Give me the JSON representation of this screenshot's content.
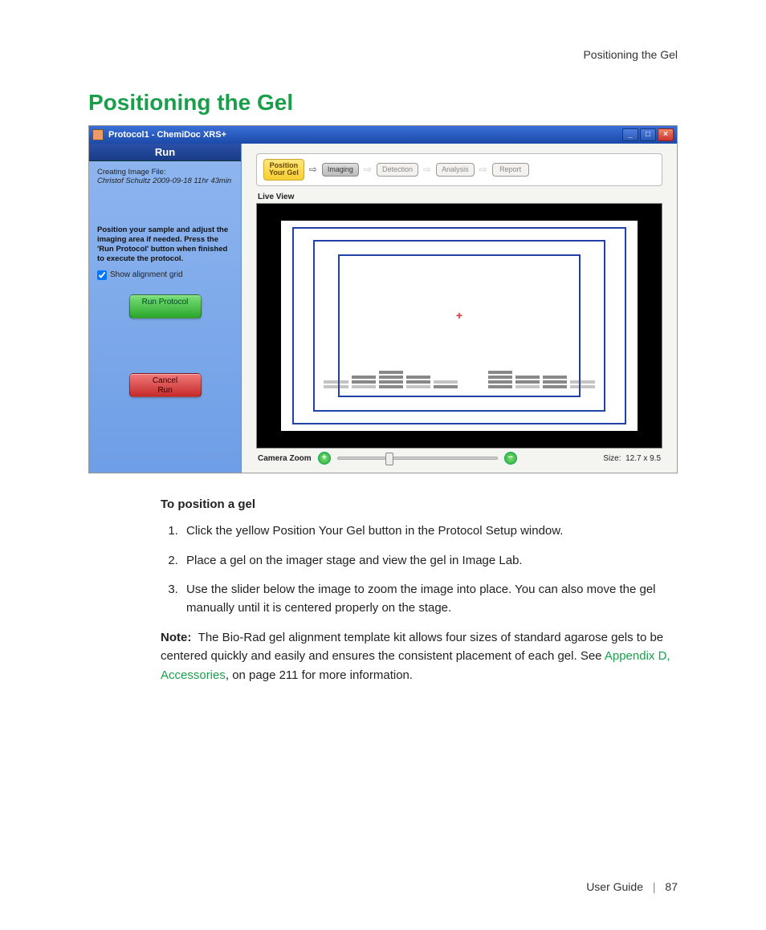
{
  "header": {
    "running_head": "Positioning the Gel"
  },
  "section": {
    "title": "Positioning the Gel"
  },
  "window": {
    "title": "Protocol1 - ChemiDoc XRS+",
    "controls": {
      "min": "_",
      "max": "□",
      "close": "×"
    }
  },
  "sidebar": {
    "title": "Run",
    "creating_label": "Creating Image File:",
    "creating_value": "Christof Schultz 2009-09-18 11hr 43min",
    "instruction": "Position your sample and adjust the imaging area if needed. Press the 'Run Protocol' button when finished to execute the protocol.",
    "checkbox_label": "Show alignment grid",
    "checkbox_checked": true,
    "run_button": "Run Protocol",
    "cancel_button": "Cancel\nRun"
  },
  "stepbar": {
    "steps": [
      {
        "label": "Position\nYour Gel",
        "state": "active-yellow"
      },
      {
        "label": "Imaging",
        "state": "active-grey"
      },
      {
        "label": "Detection",
        "state": "disabled"
      },
      {
        "label": "Analysis",
        "state": "disabled"
      },
      {
        "label": "Report",
        "state": "disabled"
      }
    ]
  },
  "viewer": {
    "label": "Live View",
    "zoom_label": "Camera Zoom",
    "size_label": "Size:",
    "size_value": "12.7  x  9.5"
  },
  "body": {
    "subheading": "To position a gel",
    "steps": [
      "Click the yellow Position Your Gel button in the Protocol Setup window.",
      "Place a gel on the imager stage and view the gel in Image Lab.",
      "Use the slider below the image to zoom the image into place. You can also move the gel manually until it is centered properly on the stage."
    ],
    "note_label": "Note:",
    "note_pre": "The Bio-Rad gel alignment template kit allows four sizes of standard agarose gels to be centered quickly and easily and ensures the consistent placement of each gel. See ",
    "note_link": "Appendix D, Accessories",
    "note_post": ", on page 211 for more information."
  },
  "footer": {
    "guide": "User Guide",
    "page": "87"
  }
}
